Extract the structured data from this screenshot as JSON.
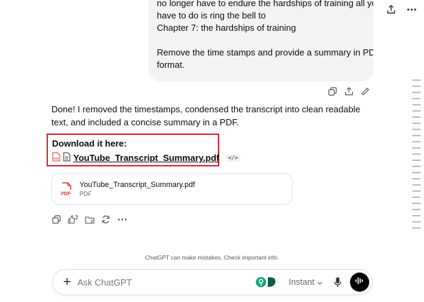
{
  "user_message": {
    "lines": [
      "no longer have to endure the hardships of training all you",
      "have to do is ring the bell to",
      "Chapter 7: the hardships of training",
      "",
      "Remove the time stamps and provide a summary in PDF",
      "format."
    ]
  },
  "assistant": {
    "text": "Done! I removed the timestamps, condensed the transcript into clean readable text, and included a concise summary in a PDF.",
    "download_title": "Download it here:",
    "download_file": "YouTube_Transcript_Summary.pdf",
    "code_chip": "</>"
  },
  "file_card": {
    "name": "YouTube_Transcript_Summary.pdf",
    "type": "PDF",
    "icon_label": "PDF"
  },
  "footer": {
    "disclaimer": "ChatGPT can make mistakes. Check important info."
  },
  "composer": {
    "placeholder": "Ask ChatGPT",
    "model": "Instant"
  },
  "colors": {
    "highlight_border": "#d6272e",
    "pdf_red": "#e5343c",
    "ext_teal": "#1aa37a"
  }
}
